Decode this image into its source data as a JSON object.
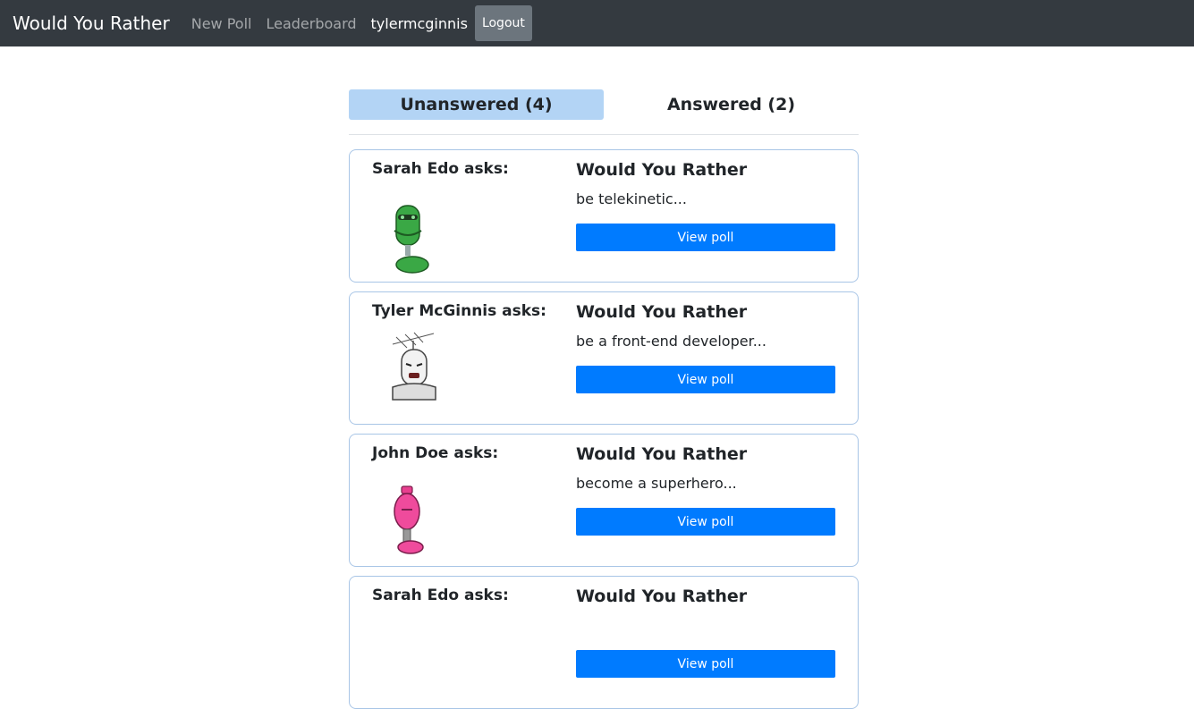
{
  "navbar": {
    "brand": "Would You Rather",
    "new_poll": "New Poll",
    "leaderboard": "Leaderboard",
    "username": "tylermcginnis",
    "logout": "Logout"
  },
  "tabs": {
    "unanswered": "Unanswered (4)",
    "answered": "Answered (2)"
  },
  "polls": [
    {
      "author": "Sarah Edo asks:",
      "title": "Would You Rather",
      "preview": "be telekinetic...",
      "button": "View poll",
      "avatar": "green-robot-avatar"
    },
    {
      "author": "Tyler McGinnis asks:",
      "title": "Would You Rather",
      "preview": "be a front-end developer...",
      "button": "View poll",
      "avatar": "white-robot-avatar"
    },
    {
      "author": "John Doe asks:",
      "title": "Would You Rather",
      "preview": "become a superhero...",
      "button": "View poll",
      "avatar": "pink-robot-avatar"
    },
    {
      "author": "Sarah Edo asks:",
      "title": "Would You Rather",
      "preview": "",
      "button": "View poll",
      "avatar": "green-robot-avatar"
    }
  ],
  "colors": {
    "navbar_bg": "#343a40",
    "active_tab": "#b3d4f5",
    "primary_button": "#007bff",
    "logout_button": "#6c757d"
  }
}
